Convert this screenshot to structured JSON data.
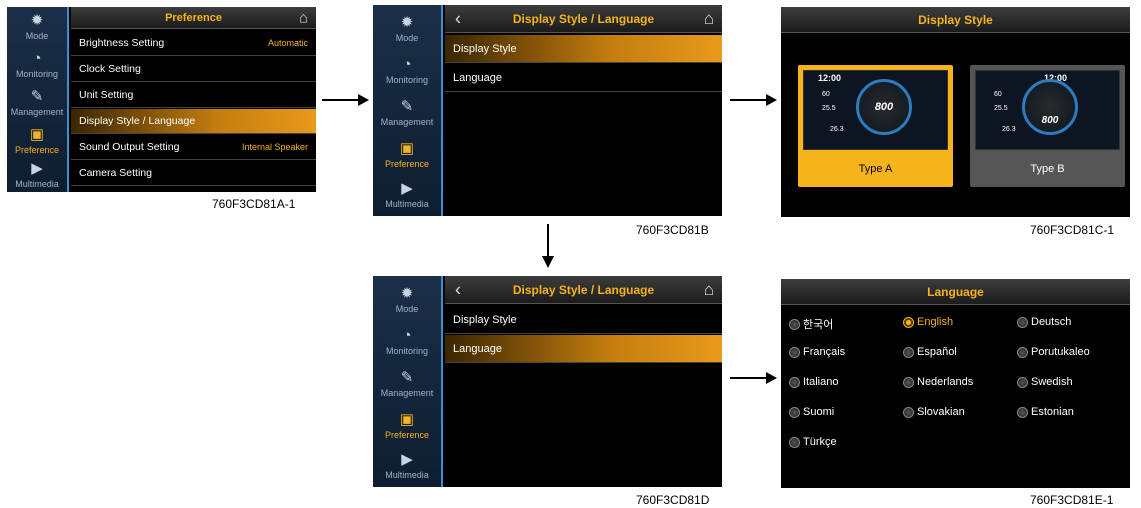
{
  "sidebar": {
    "items": [
      {
        "icon": "gear-icon",
        "label": "Mode"
      },
      {
        "icon": "gauge-icon",
        "label": "Monitoring"
      },
      {
        "icon": "wrench-icon",
        "label": "Management"
      },
      {
        "icon": "monitor-icon",
        "label": "Preference"
      },
      {
        "icon": "play-icon",
        "label": "Multimedia"
      }
    ]
  },
  "screen_a": {
    "title": "Preference",
    "caption": "760F3CD81A-1",
    "rows": [
      {
        "label": "Brightness Setting",
        "value": "Automatic"
      },
      {
        "label": "Clock Setting",
        "value": ""
      },
      {
        "label": "Unit Setting",
        "value": ""
      },
      {
        "label": "Display Style / Language",
        "value": ""
      },
      {
        "label": "Sound Output Setting",
        "value": "Internal Speaker"
      },
      {
        "label": "Camera Setting",
        "value": ""
      }
    ],
    "selected_index": 3
  },
  "screen_b": {
    "title": "Display Style / Language",
    "caption": "760F3CD81B",
    "rows": [
      {
        "label": "Display Style"
      },
      {
        "label": "Language"
      }
    ],
    "selected_index": 0
  },
  "screen_c": {
    "title": "Display Style",
    "caption": "760F3CD81C-1",
    "types": [
      {
        "label": "Type A",
        "selected": true
      },
      {
        "label": "Type B",
        "selected": false
      }
    ],
    "dash": {
      "time": "12:00",
      "value_a": "60",
      "value_b": "25.5",
      "value_c": "26.3",
      "rpm": "800"
    }
  },
  "screen_d": {
    "title": "Display Style / Language",
    "caption": "760F3CD81D",
    "rows": [
      {
        "label": "Display Style"
      },
      {
        "label": "Language"
      }
    ],
    "selected_index": 1
  },
  "screen_e": {
    "title": "Language",
    "caption": "760F3CD81E-1",
    "options": [
      {
        "label": "한국어",
        "selected": false
      },
      {
        "label": "English",
        "selected": true
      },
      {
        "label": "Deutsch",
        "selected": false
      },
      {
        "label": "Français",
        "selected": false
      },
      {
        "label": "Español",
        "selected": false
      },
      {
        "label": "Porutukaleo",
        "selected": false
      },
      {
        "label": "Italiano",
        "selected": false
      },
      {
        "label": "Nederlands",
        "selected": false
      },
      {
        "label": "Swedish",
        "selected": false
      },
      {
        "label": "Suomi",
        "selected": false
      },
      {
        "label": "Slovakian",
        "selected": false
      },
      {
        "label": "Estonian",
        "selected": false
      },
      {
        "label": "Türkçe",
        "selected": false
      }
    ]
  },
  "colors": {
    "accent": "#f6b31a",
    "sidebar_border": "#3a8fd0"
  }
}
